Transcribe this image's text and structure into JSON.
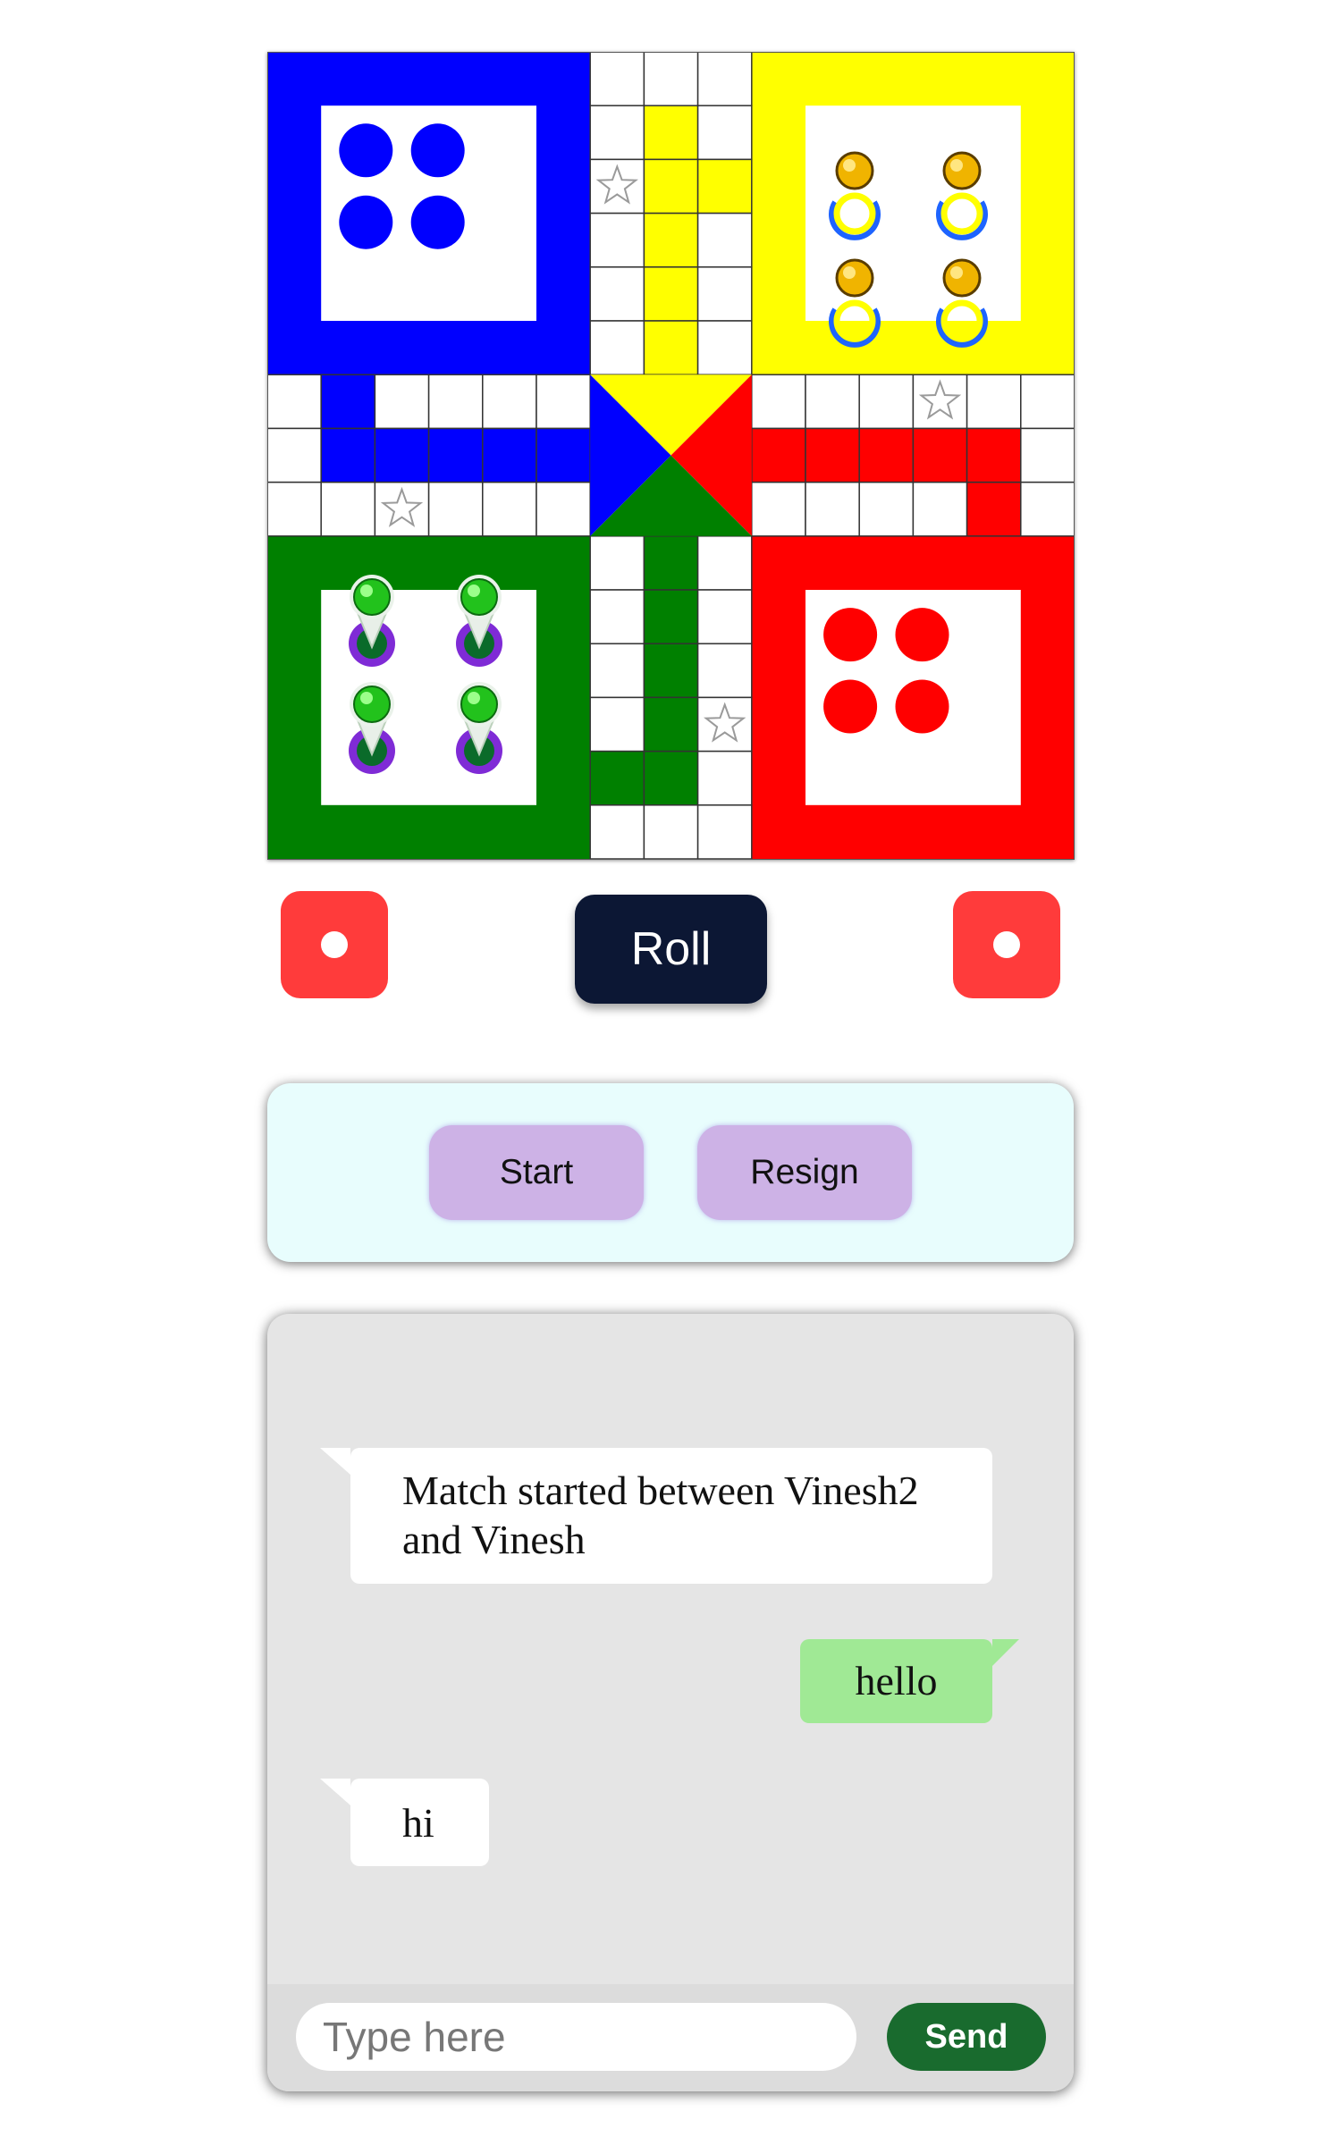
{
  "board": {
    "colors": {
      "blue": "#0000ff",
      "yellow": "#ffff00",
      "green": "#008000",
      "red": "#ff0000"
    },
    "tokens": {
      "yellow": 4,
      "green": 4
    },
    "star_icon": "star-icon"
  },
  "dice": {
    "left_value": 1,
    "right_value": 1,
    "color": "#ff3b3b"
  },
  "roll": {
    "label": "Roll"
  },
  "controls": {
    "start_label": "Start",
    "resign_label": "Resign"
  },
  "chat": {
    "messages": [
      {
        "side": "in",
        "text": "Match started between Vinesh2 and Vinesh"
      },
      {
        "side": "out",
        "text": "hello"
      },
      {
        "side": "in",
        "text": "hi"
      }
    ],
    "input_placeholder": "Type here",
    "send_label": "Send"
  }
}
